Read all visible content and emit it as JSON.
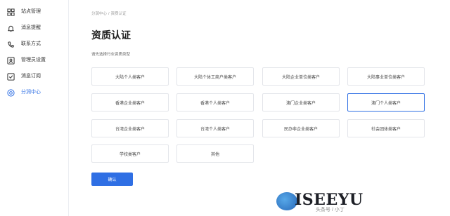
{
  "sidebar": {
    "items": [
      {
        "label": "站点管理",
        "icon": "grid-icon",
        "active": false
      },
      {
        "label": "消息提醒",
        "icon": "bell-icon",
        "active": false
      },
      {
        "label": "联系方式",
        "icon": "phone-icon",
        "active": false
      },
      {
        "label": "管理员设置",
        "icon": "admin-user-icon",
        "active": false
      },
      {
        "label": "消息订阅",
        "icon": "subscribe-icon",
        "active": false
      },
      {
        "label": "分润中心",
        "icon": "profit-icon",
        "active": true
      }
    ]
  },
  "breadcrumb": {
    "parent": "分润中心",
    "separator": "/",
    "current": "资质认证"
  },
  "page": {
    "title": "资质认证",
    "subtitle": "请先选择行业资质类型"
  },
  "options": [
    {
      "label": "大陆个人类客户",
      "selected": false
    },
    {
      "label": "大陆个体工商户类客户",
      "selected": false
    },
    {
      "label": "大陆企业单位类客户",
      "selected": false
    },
    {
      "label": "大陆事业单位类客户",
      "selected": false
    },
    {
      "label": "香港企业类客户",
      "selected": false
    },
    {
      "label": "香港个人类客户",
      "selected": false
    },
    {
      "label": "澳门企业类客户",
      "selected": false
    },
    {
      "label": "澳门个人类客户",
      "selected": true
    },
    {
      "label": "台湾企业类客户",
      "selected": false
    },
    {
      "label": "台湾个人类客户",
      "selected": false
    },
    {
      "label": "民办非企业类客户",
      "selected": false
    },
    {
      "label": "社会团体类客户",
      "selected": false
    },
    {
      "label": "学校类客户",
      "selected": false
    },
    {
      "label": "其他",
      "selected": false
    }
  ],
  "confirm_label": "确认",
  "watermark": {
    "logo_text": "ISEEYU",
    "sub_text": "头条号 / 小丁"
  },
  "colors": {
    "accent": "#2f6fe4",
    "border": "#e3e5ea",
    "text": "#333333"
  }
}
